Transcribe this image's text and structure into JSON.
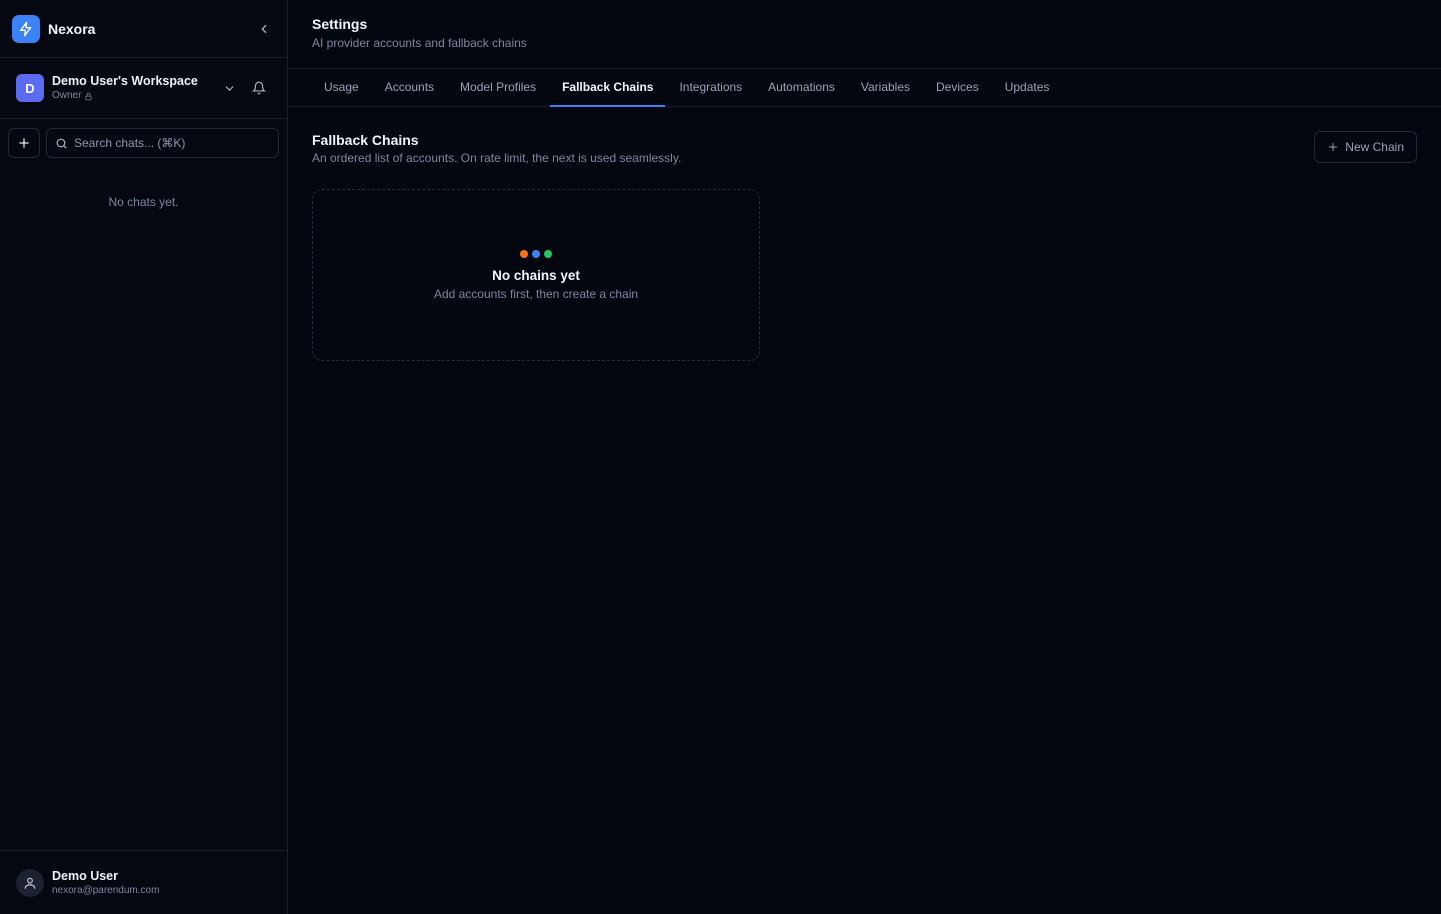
{
  "app": {
    "name": "Nexora",
    "logo_color": "#3b82f6"
  },
  "workspace": {
    "initial": "D",
    "name": "Demo User's Workspace",
    "role": "Owner"
  },
  "search": {
    "placeholder": "Search chats... (⌘K)"
  },
  "chats": {
    "empty_text": "No chats yet."
  },
  "user": {
    "name": "Demo User",
    "email": "nexora@parendum.com"
  },
  "header": {
    "title": "Settings",
    "subtitle": "AI provider accounts and fallback chains"
  },
  "tabs": [
    {
      "label": "Usage",
      "active": false
    },
    {
      "label": "Accounts",
      "active": false
    },
    {
      "label": "Model Profiles",
      "active": false
    },
    {
      "label": "Fallback Chains",
      "active": true
    },
    {
      "label": "Integrations",
      "active": false
    },
    {
      "label": "Automations",
      "active": false
    },
    {
      "label": "Variables",
      "active": false
    },
    {
      "label": "Devices",
      "active": false
    },
    {
      "label": "Updates",
      "active": false
    }
  ],
  "section": {
    "title": "Fallback Chains",
    "subtitle": "An ordered list of accounts. On rate limit, the next is used seamlessly.",
    "new_button_label": "New Chain"
  },
  "empty_state": {
    "title": "No chains yet",
    "subtitle": "Add accounts first, then create a chain",
    "dot_colors": [
      "#f97316",
      "#3b82f6",
      "#22c55e"
    ]
  },
  "colors": {
    "accent": "#3b82f6",
    "background": "#03060f"
  }
}
